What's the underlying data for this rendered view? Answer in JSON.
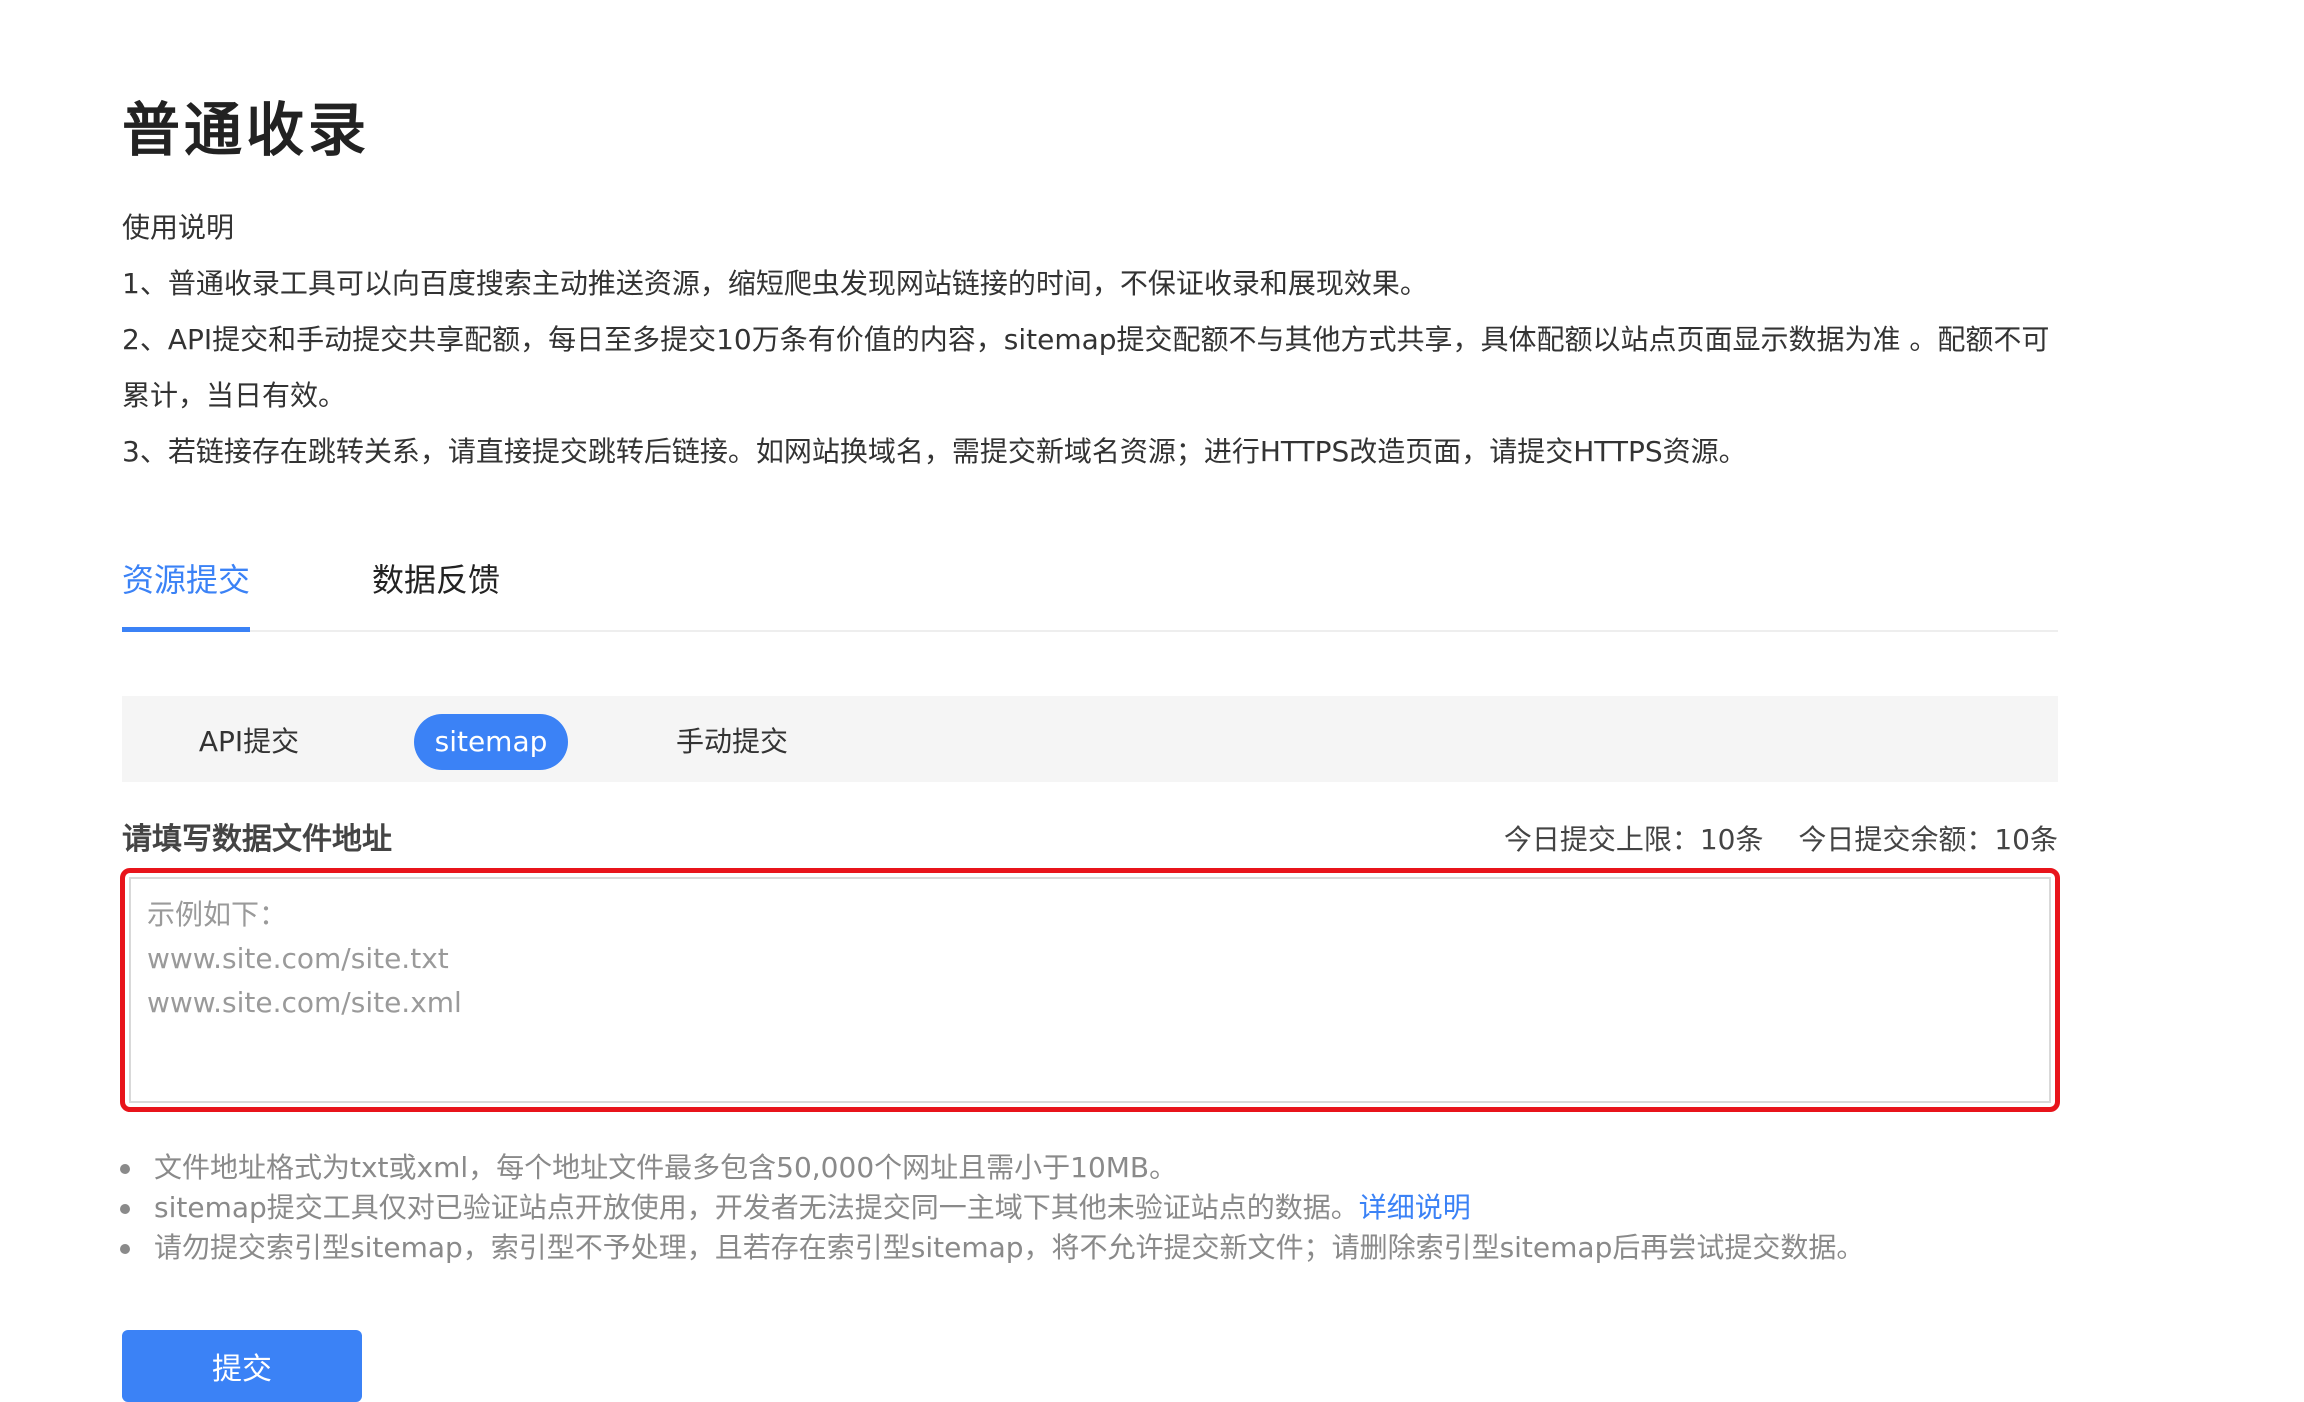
{
  "header": {
    "title": "普通收录"
  },
  "instructions": {
    "heading": "使用说明",
    "items": [
      "1、普通收录工具可以向百度搜索主动推送资源，缩短爬虫发现网站链接的时间，不保证收录和展现效果。",
      "2、API提交和手动提交共享配额，每日至多提交10万条有价值的内容，sitemap提交配额不与其他方式共享，具体配额以站点页面显示数据为准 。配额不可累计，当日有效。",
      "3、若链接存在跳转关系，请直接提交跳转后链接。如网站换域名，需提交新域名资源；进行HTTPS改造页面，请提交HTTPS资源。"
    ]
  },
  "tabs": [
    {
      "label": "资源提交",
      "active": true
    },
    {
      "label": "数据反馈",
      "active": false
    }
  ],
  "subtabs": [
    {
      "label": "API提交",
      "active": false
    },
    {
      "label": "sitemap",
      "active": true
    },
    {
      "label": "手动提交",
      "active": false
    }
  ],
  "form": {
    "label": "请填写数据文件地址",
    "quota_limit": "今日提交上限：10条",
    "quota_remaining": "今日提交余额：10条",
    "textarea_value": "",
    "textarea_placeholder": "示例如下：\nwww.site.com/site.txt\nwww.site.com/site.xml",
    "highlight_color": "#e8141b"
  },
  "notes": [
    {
      "text": "文件地址格式为txt或xml，每个地址文件最多包含50,000个网址且需小于10MB。"
    },
    {
      "text": "sitemap提交工具仅对已验证站点开放使用，开发者无法提交同一主域下其他未验证站点的数据。",
      "link": "详细说明"
    },
    {
      "text": "请勿提交索引型sitemap，索引型不予处理，且若存在索引型sitemap，将不允许提交新文件；请删除索引型sitemap后再尝试提交数据。"
    }
  ],
  "submit": {
    "label": "提交"
  },
  "colors": {
    "accent": "#3b82f6",
    "highlight": "#e8141b"
  }
}
